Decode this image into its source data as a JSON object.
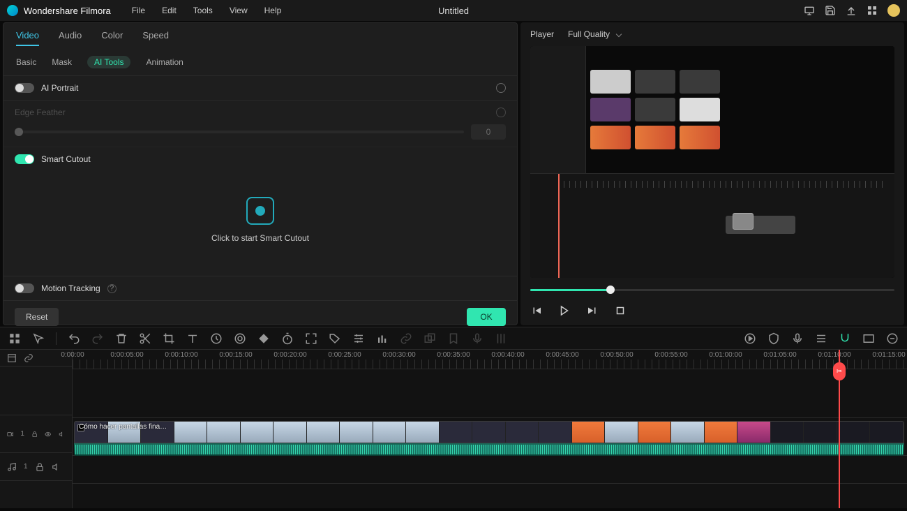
{
  "app": {
    "title": "Wondershare Filmora",
    "document": "Untitled",
    "menus": [
      "File",
      "Edit",
      "Tools",
      "View",
      "Help"
    ]
  },
  "propertyPanel": {
    "topTabs": [
      "Video",
      "Audio",
      "Color",
      "Speed"
    ],
    "topActive": "Video",
    "subTabs": [
      "Basic",
      "Mask",
      "AI Tools",
      "Animation"
    ],
    "subActive": "AI Tools",
    "aiPortrait": {
      "label": "AI Portrait",
      "on": false
    },
    "edgeFeather": {
      "label": "Edge Feather",
      "value": "0"
    },
    "smartCutout": {
      "label": "Smart Cutout",
      "on": true,
      "cta": "Click to start Smart Cutout"
    },
    "motionTracking": {
      "label": "Motion Tracking",
      "on": false
    },
    "reset": "Reset",
    "ok": "OK"
  },
  "player": {
    "label": "Player",
    "quality": "Full Quality",
    "scrubPercent": 22
  },
  "timeline": {
    "ruler": [
      "0:00:00",
      "0:00:05:00",
      "0:00:10:00",
      "0:00:15:00",
      "0:00:20:00",
      "0:00:25:00",
      "0:00:30:00",
      "0:00:35:00",
      "0:00:40:00",
      "0:00:45:00",
      "0:00:50:00",
      "0:00:55:00",
      "0:01:00:00",
      "0:01:05:00",
      "0:01:10:00",
      "0:01:15:00"
    ],
    "tickSpacing": 78,
    "playheadPx": 1098,
    "clip": {
      "title": "Cómo hacer pantallas fina…",
      "startPx": 2,
      "widthPx": 1190
    }
  }
}
